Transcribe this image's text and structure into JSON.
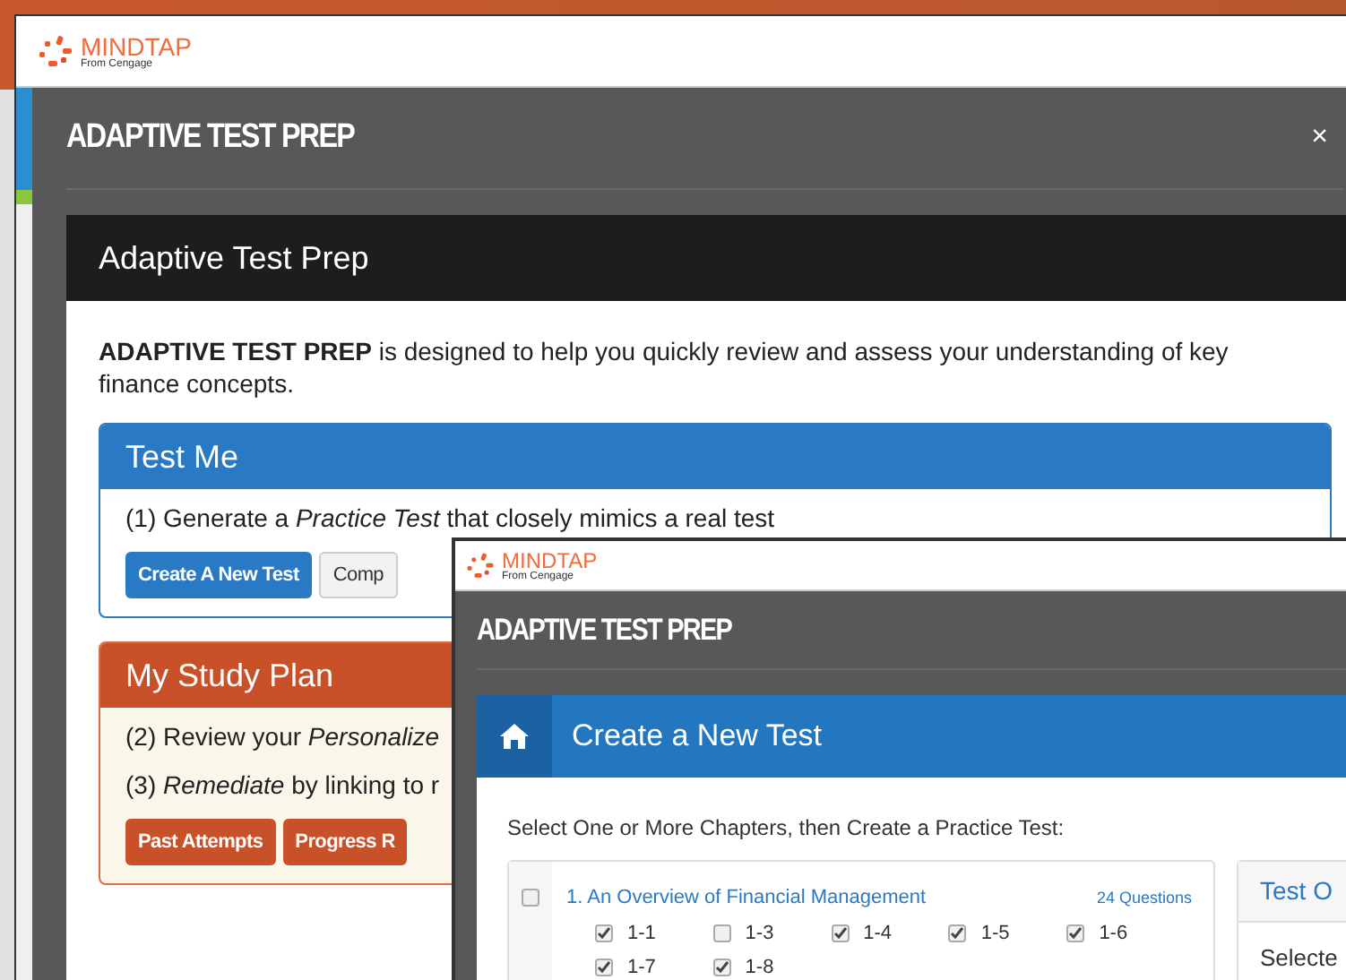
{
  "back_window": {
    "logo": {
      "name": "MINDTAP",
      "tagline": "From Cengage"
    },
    "title": "ADAPTIVE TEST PREP",
    "close": "×",
    "card_title": "Adaptive Test Prep",
    "intro": "**ADAPTIVE TEST PREP** is designed to help you quickly review and assess your understanding of key finance concepts.",
    "sections": [
      {
        "kind": "test",
        "title": "Test Me",
        "lines": [
          "(1) Generate a *Practice Test* that closely mimics a real test"
        ],
        "buttons": [
          "Create A New Test",
          "Comp"
        ]
      },
      {
        "kind": "plan",
        "title": "My Study Plan",
        "lines": [
          "(2) Review your *Personalize*",
          "(3) *Remediate* by linking to r"
        ],
        "buttons": [
          "Past Attempts",
          "Progress R"
        ]
      }
    ]
  },
  "front_window": {
    "logo": {
      "name": "MINDTAP",
      "tagline": "From Cengage"
    },
    "title": "ADAPTIVE TEST PREP",
    "header": "Create a New Test",
    "instruction": "Select One or More Chapters, then Create a Practice Test:",
    "chapters": [
      {
        "title": "1. An Overview of Financial Management",
        "count": "24 Questions",
        "checked": false,
        "sections": [
          {
            "label": "1-1",
            "checked": true
          },
          {
            "label": "1-3",
            "checked": false
          },
          {
            "label": "1-4",
            "checked": true
          },
          {
            "label": "1-5",
            "checked": true
          },
          {
            "label": "1-6",
            "checked": true
          },
          {
            "label": "1-7",
            "checked": true
          },
          {
            "label": "1-8",
            "checked": true
          }
        ]
      }
    ],
    "side_panel": {
      "title": "Test O",
      "text": "Selecte"
    }
  }
}
